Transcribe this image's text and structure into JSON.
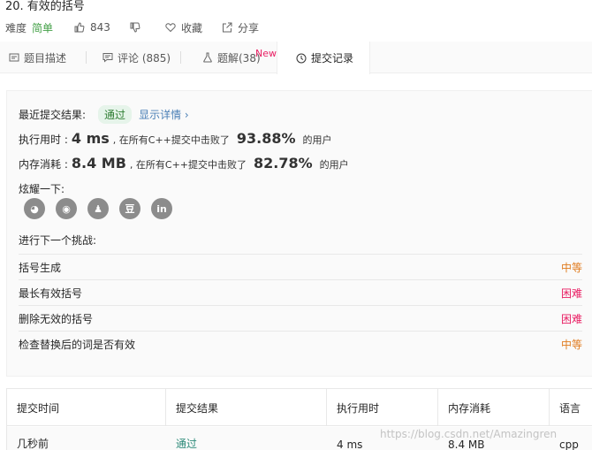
{
  "problem": {
    "title": "20. 有效的括号",
    "difficulty_label": "难度",
    "difficulty": "简单",
    "likes": "843",
    "favorite_label": "收藏",
    "share_label": "分享"
  },
  "tabs": [
    {
      "label": "题目描述",
      "icon": "document-icon"
    },
    {
      "label": "评论 (885)",
      "icon": "comment-icon"
    },
    {
      "label": "题解(38)",
      "icon": "flask-icon"
    },
    {
      "label": "提交记录",
      "icon": "clock-icon",
      "active": true
    }
  ],
  "new_badge": "New",
  "result": {
    "label": "最近提交结果:",
    "status": "通过",
    "details_link": "显示详情 ›"
  },
  "runtime": {
    "label": "执行用时 :",
    "value": "4 ms",
    "mid": ", 在所有C++提交中击败了",
    "percent": "93.88%",
    "suffix": "的用户"
  },
  "memory": {
    "label": "内存消耗 :",
    "value": "8.4 MB",
    "mid": ", 在所有C++提交中击败了",
    "percent": "82.78%",
    "suffix": "的用户"
  },
  "share": {
    "label": "炫耀一下:",
    "icons": [
      "wechat-icon",
      "weibo-icon",
      "qq-icon",
      "douban-icon",
      "linkedin-icon"
    ],
    "glyphs": [
      "◕",
      "◉",
      "♟",
      "豆",
      "in"
    ]
  },
  "next": {
    "label": "进行下一个挑战:",
    "items": [
      {
        "name": "括号生成",
        "level": "中等",
        "level_color": "#e07b1e"
      },
      {
        "name": "最长有效括号",
        "level": "困难",
        "level_color": "#e91e63"
      },
      {
        "name": "删除无效的括号",
        "level": "困难",
        "level_color": "#e91e63"
      },
      {
        "name": "检查替换后的词是否有效",
        "level": "中等",
        "level_color": "#e07b1e"
      }
    ]
  },
  "table": {
    "headers": [
      "提交时间",
      "提交结果",
      "执行用时",
      "内存消耗",
      "语言"
    ],
    "row": [
      "几秒前",
      "通过",
      "4 ms",
      "8.4 MB",
      "cpp"
    ]
  },
  "watermark": "https://blog.csdn.net/Amazingren"
}
